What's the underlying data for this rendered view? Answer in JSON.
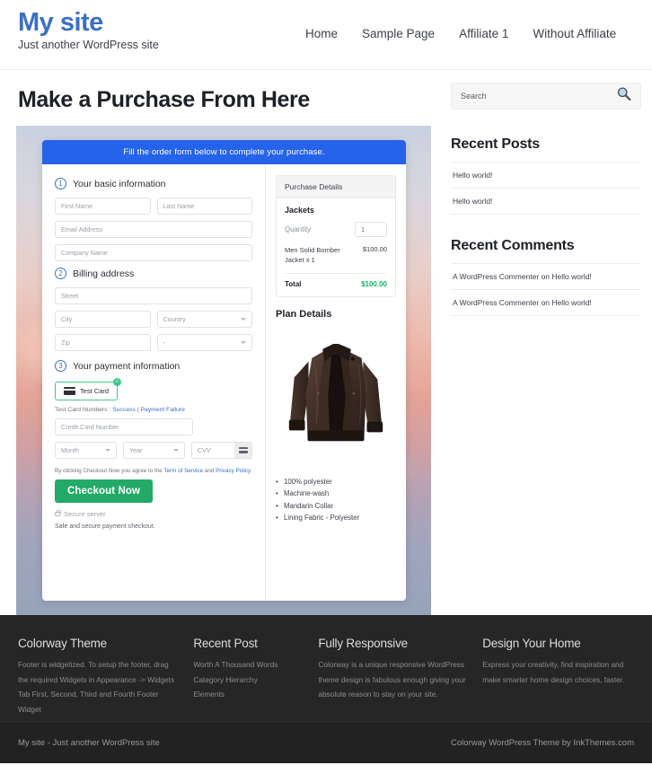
{
  "header": {
    "site_title": "My site",
    "tagline": "Just another WordPress site",
    "nav": [
      {
        "label": "Home"
      },
      {
        "label": "Sample Page"
      },
      {
        "label": "Affiliate 1"
      },
      {
        "label": "Without Affiliate"
      }
    ]
  },
  "main": {
    "page_title": "Make a Purchase From Here",
    "form": {
      "banner": "Fill the order form below to complete your purchase.",
      "steps": [
        {
          "num": "1",
          "label": "Your basic information"
        },
        {
          "num": "2",
          "label": "Billing address"
        },
        {
          "num": "3",
          "label": "Your payment information"
        }
      ],
      "fields": {
        "first_name": "First Name",
        "last_name": "Last Name",
        "email": "Email Address",
        "company": "Company Name",
        "street": "Street",
        "city": "City",
        "country": "Country",
        "zip": "Zip",
        "state": "-",
        "card_number": "Credit Card Number",
        "month": "Month",
        "year": "Year",
        "cvv": "CVV"
      },
      "payment_method": "Test  Card",
      "test_numbers_prefix": "Test Card Numbers : ",
      "test_success": "Success",
      "test_divider": " | ",
      "test_failure": "Payment Failure",
      "terms_prefix": "By clicking Checkout Now you agree to the ",
      "terms_tos": "Term of Service",
      "terms_and": " and ",
      "terms_privacy": "Privacy Policy",
      "checkout_label": "Checkout Now",
      "secure_server": "Secure server",
      "secure_note": "Safe and secure payment checkout."
    },
    "purchase_details": {
      "heading": "Purchase Details",
      "product": "Jackets",
      "quantity_label": "Quantity",
      "quantity_value": "1",
      "line_item_name": "Men Solid Bomber Jacket x 1",
      "line_item_price": "$100.00",
      "total_label": "Total",
      "total_value": "$100.00"
    },
    "plan_details": {
      "heading": "Plan Details",
      "features": [
        "100% polyester",
        "Machine-wash",
        "Mandarin Collar",
        "Lining Fabric - Polyester"
      ]
    }
  },
  "sidebar": {
    "search_placeholder": "Search",
    "widgets": [
      {
        "title": "Recent Posts",
        "items": [
          "Hello world!",
          "Hello world!"
        ]
      },
      {
        "title": "Recent Comments",
        "items": [
          "A WordPress Commenter on Hello world!",
          "A WordPress Commenter on Hello world!"
        ]
      }
    ]
  },
  "footer": {
    "columns": [
      {
        "title": "Colorway Theme",
        "text": "Footer is widgetized. To setup the footer, drag the required Widgets in Appearance -> Widgets Tab First, Second, Third and Fourth Footer Widget"
      },
      {
        "title": "Recent Post",
        "links": [
          "Worth A Thousand Words",
          "Category Hierarchy",
          "Elements"
        ]
      },
      {
        "title": "Fully Responsive",
        "text": "Colorway is a unique responsive WordPress theme design is fabulous enough giving your absolute reason to stay on your site."
      },
      {
        "title": "Design Your Home",
        "text": "Express your creativity, find inspiration and make smarter home design choices, faster."
      }
    ],
    "bar_left": "My site - Just another WordPress site",
    "bar_right": "Colorway WordPress Theme by InkThemes.com"
  },
  "colors": {
    "brand_blue": "#3b6fc4",
    "banner_blue": "#2563eb",
    "checkout_green": "#22aa66",
    "total_green": "#16b262",
    "footer_dark": "#262626"
  }
}
